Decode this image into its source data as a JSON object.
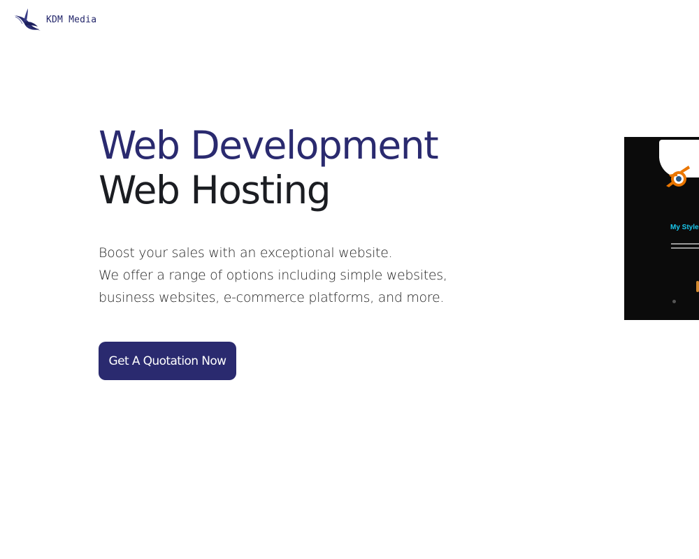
{
  "brand": {
    "name": "KDM Media"
  },
  "hero": {
    "title_line_1": "Web Development",
    "title_line_2": "Web Hosting",
    "description_lines": [
      "Boost your sales with an exceptional website.",
      "We offer a range of options including simple websites,",
      "business websites, e-commerce platforms, and more."
    ],
    "cta_label": "Get A Quotation Now"
  },
  "preview": {
    "heading": "My Styles",
    "logo_icon": "blender-logo-icon"
  },
  "colors": {
    "primary": "#2a2a6f",
    "heading_dark": "#1b1d22",
    "text": "#232323",
    "preview_bg": "#0b0b0b",
    "preview_accent": "#19c8ee",
    "preview_logo_orange": "#ea7600"
  }
}
